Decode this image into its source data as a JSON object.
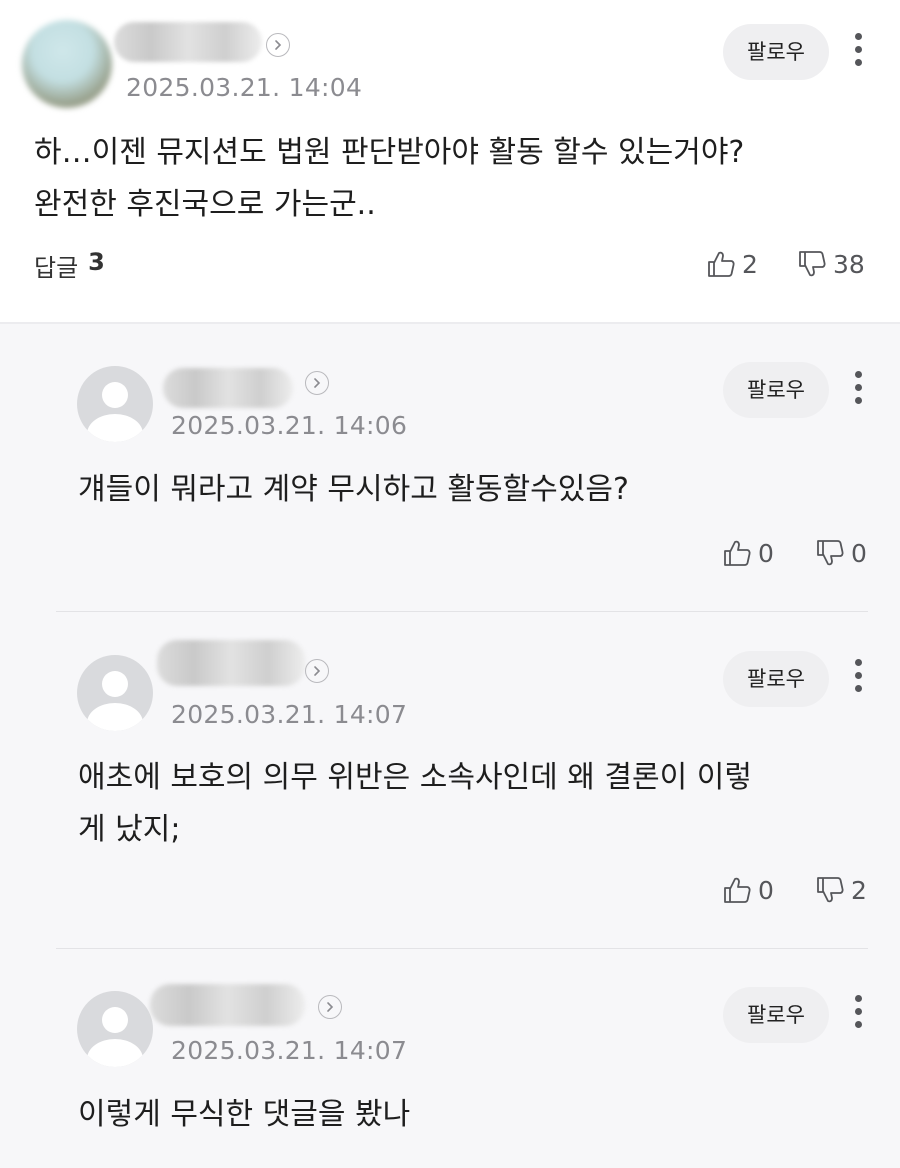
{
  "main_comment": {
    "timestamp": "2025.03.21. 14:04",
    "follow_label": "팔로우",
    "text_line1": "하…이젠 뮤지션도 법원 판단받아야 활동 할수 있는거야?",
    "text_line2": "완전한 후진국으로 가는군..",
    "reply_label": "답글",
    "reply_count": "3",
    "likes": "2",
    "dislikes": "38"
  },
  "replies": [
    {
      "timestamp": "2025.03.21. 14:06",
      "follow_label": "팔로우",
      "text_line1": "걔들이 뭐라고 계약 무시하고 활동할수있음?",
      "likes": "0",
      "dislikes": "0"
    },
    {
      "timestamp": "2025.03.21. 14:07",
      "follow_label": "팔로우",
      "text_line1": "애초에 보호의 의무 위반은 소속사인데 왜 결론이 이렇",
      "text_line2": "게 났지;",
      "likes": "0",
      "dislikes": "2"
    },
    {
      "timestamp": "2025.03.21. 14:07",
      "follow_label": "팔로우",
      "text_line1": "이렇게 무식한 댓글을 봤나"
    }
  ],
  "icons": {
    "chevron": "chevron-right-icon",
    "more": "more-vertical-icon",
    "like": "thumbs-up-icon",
    "dislike": "thumbs-down-icon"
  },
  "colors": {
    "reply_background": "#f7f7f9",
    "timestamp": "#8b8b90",
    "follow_button_bg": "#efeff1"
  }
}
